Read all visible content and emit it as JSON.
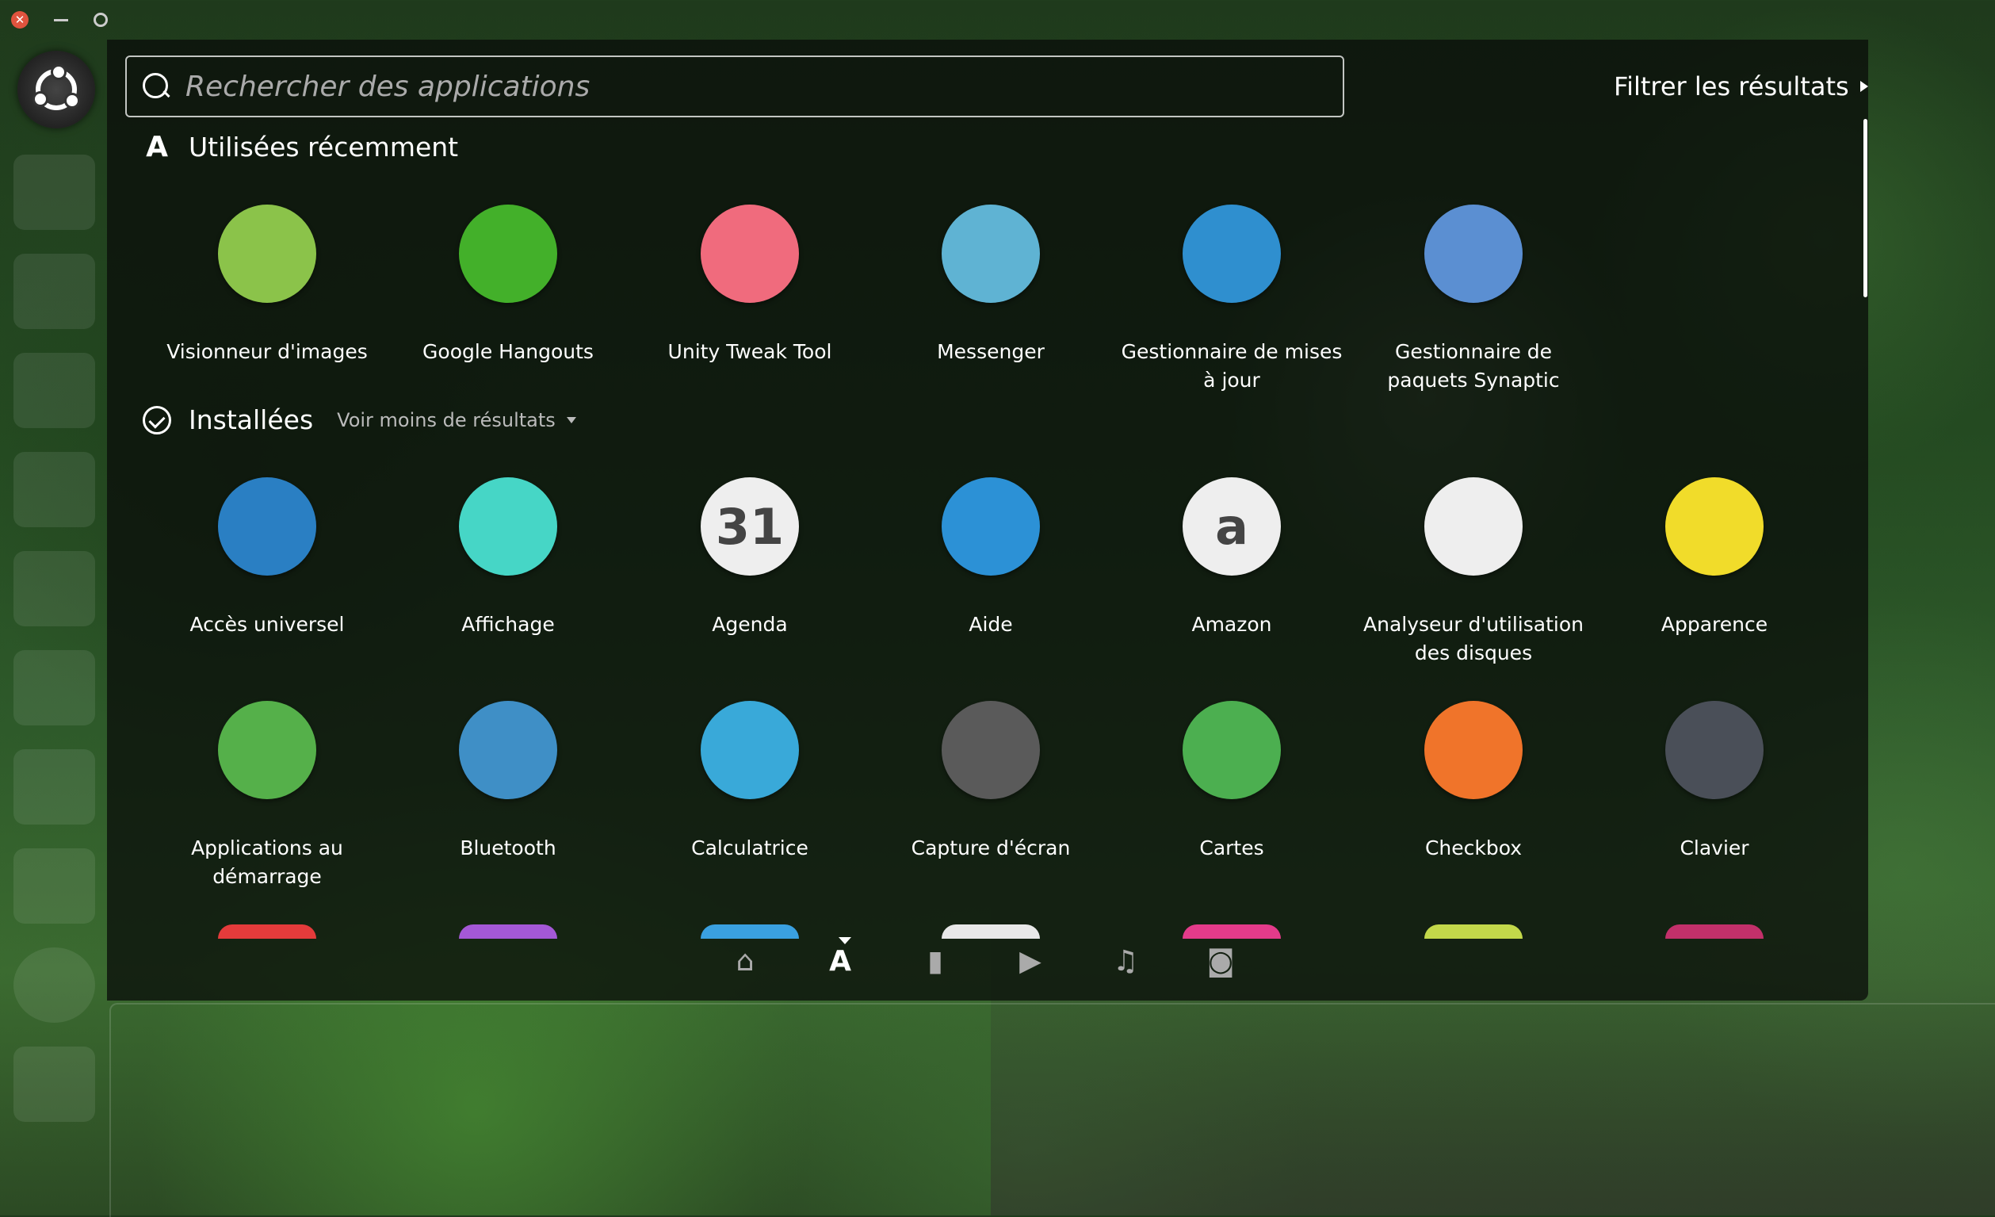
{
  "search": {
    "placeholder": "Rechercher des applications"
  },
  "filter": {
    "label": "Filtrer les résultats"
  },
  "recent": {
    "title": "Utilisées récemment",
    "apps": [
      {
        "label": "Visionneur d'images",
        "color": "#8bc34a"
      },
      {
        "label": "Google Hangouts",
        "color": "#43b02a"
      },
      {
        "label": "Unity Tweak Tool",
        "color": "#f06b7d"
      },
      {
        "label": "Messenger",
        "color": "#5fb3d3"
      },
      {
        "label": "Gestionnaire de mises à jour",
        "color": "#2f8fcf"
      },
      {
        "label": "Gestionnaire de paquets Synaptic",
        "color": "#5b8fd2"
      }
    ]
  },
  "installed": {
    "title": "Installées",
    "less_label": "Voir moins de résultats",
    "apps": [
      {
        "label": "Accès universel",
        "color": "#2a7fc3"
      },
      {
        "label": "Affichage",
        "color": "#46d6c6"
      },
      {
        "label": "Agenda",
        "color": "#eeeeee",
        "glyph": "31"
      },
      {
        "label": "Aide",
        "color": "#2c91d6"
      },
      {
        "label": "Amazon",
        "color": "#eeeeee",
        "glyph": "a"
      },
      {
        "label": "Analyseur d'utilisation des disques",
        "color": "#eeeeee"
      },
      {
        "label": "Apparence",
        "color": "#f1dc2a"
      },
      {
        "label": "Applications au démarrage",
        "color": "#55b04a"
      },
      {
        "label": "Bluetooth",
        "color": "#3f8fc6"
      },
      {
        "label": "Calculatrice",
        "color": "#39a9d9"
      },
      {
        "label": "Capture d'écran",
        "color": "#5a5a5a"
      },
      {
        "label": "Cartes",
        "color": "#4caf50"
      },
      {
        "label": "Checkbox",
        "color": "#f0742a"
      },
      {
        "label": "Clavier",
        "color": "#4a4f58"
      }
    ],
    "partial_colors": [
      "#e43b3b",
      "#a458d6",
      "#3aa0e0",
      "#e8e8e8",
      "#e43b8a",
      "#c3d84a",
      "#c2306a"
    ]
  },
  "lenses": [
    "home-icon",
    "applications-icon",
    "files-icon",
    "video-icon",
    "music-icon",
    "photos-icon"
  ]
}
